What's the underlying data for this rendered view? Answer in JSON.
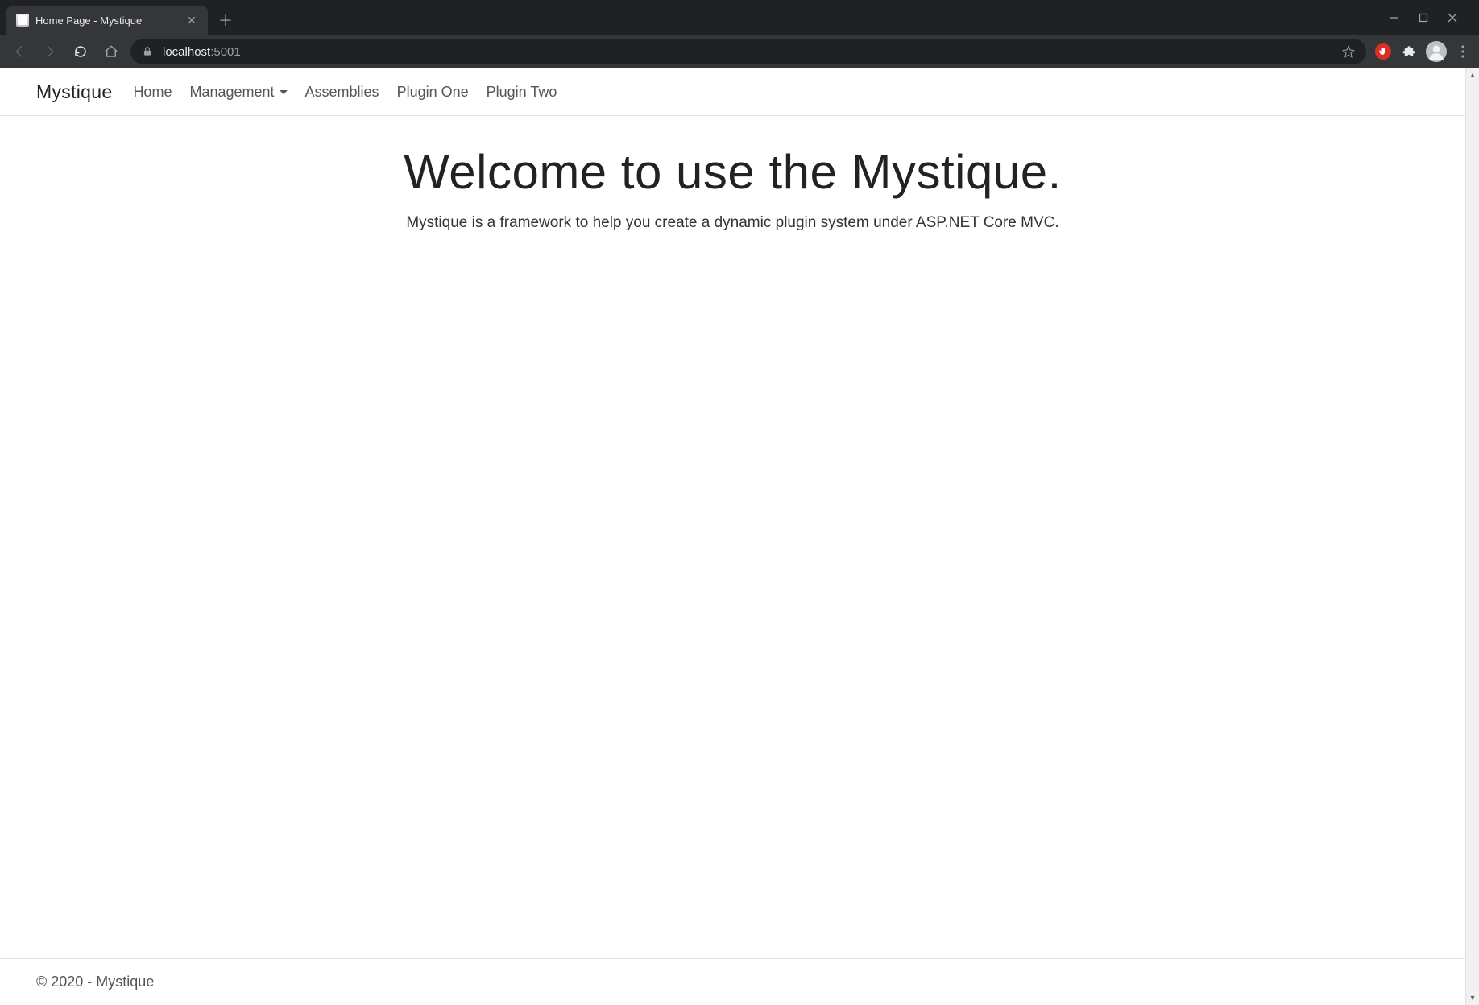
{
  "browser": {
    "tab_title": "Home Page - Mystique",
    "url_host": "localhost",
    "url_port": ":5001"
  },
  "navbar": {
    "brand": "Mystique",
    "links": {
      "home": "Home",
      "management": "Management",
      "assemblies": "Assemblies",
      "plugin_one": "Plugin One",
      "plugin_two": "Plugin Two"
    }
  },
  "main": {
    "title": "Welcome to use the Mystique.",
    "subtitle": "Mystique is a framework to help you create a dynamic plugin system under ASP.NET Core MVC."
  },
  "footer": {
    "text": "© 2020 - Mystique"
  }
}
